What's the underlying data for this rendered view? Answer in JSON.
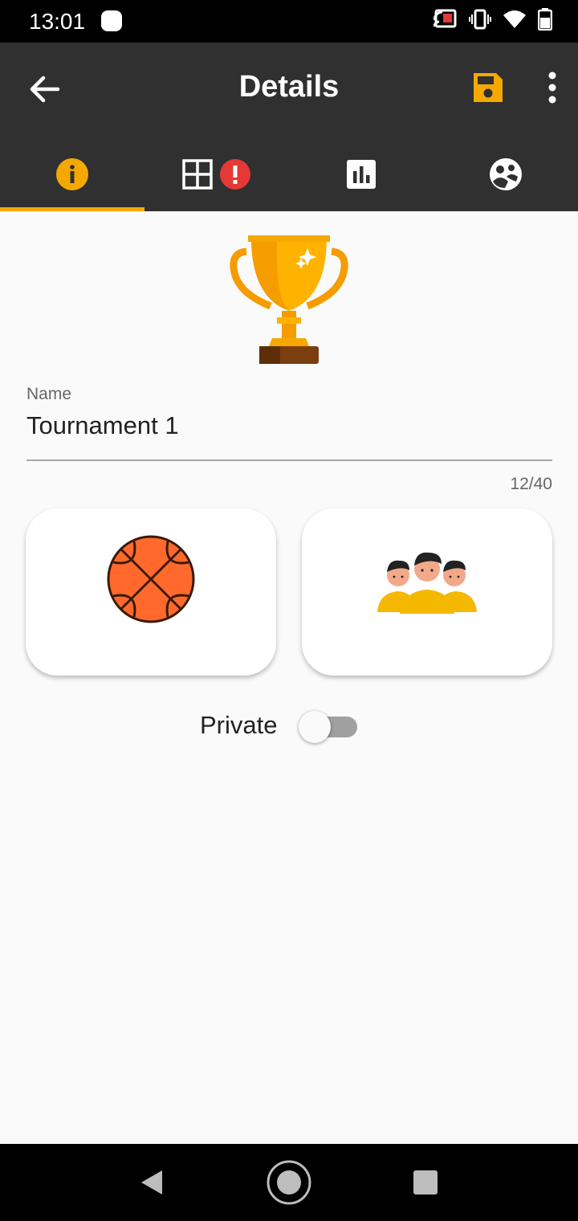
{
  "status_bar": {
    "time": "13:01",
    "icons": [
      "cast-icon",
      "vibrate-icon",
      "wifi-icon",
      "battery-icon"
    ]
  },
  "app_bar": {
    "title": "Details",
    "back_icon": "arrow-left-icon",
    "save_icon": "floppy-disk-icon",
    "more_icon": "more-vertical-icon",
    "accent_color": "#f5a800"
  },
  "tabs": [
    {
      "icon": "info-icon",
      "selected": true
    },
    {
      "icon": "grid-icon",
      "badge_icon": "error-icon",
      "selected": false
    },
    {
      "icon": "bar-chart-icon",
      "selected": false
    },
    {
      "icon": "people-icon",
      "selected": false
    }
  ],
  "form": {
    "name_label": "Name",
    "name_value": "Tournament 1",
    "name_counter": "12/40",
    "sport_icon": "basketball-icon",
    "team_icon": "team-players-icon",
    "private_label": "Private",
    "private_on": false
  },
  "navbar": {
    "icons": [
      "back-triangle-icon",
      "home-circle-icon",
      "recents-square-icon"
    ]
  }
}
